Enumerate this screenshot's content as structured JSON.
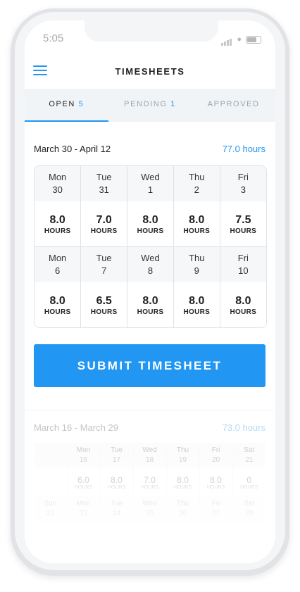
{
  "status_bar": {
    "time": "5:05"
  },
  "header": {
    "title": "TIMESHEETS"
  },
  "tabs": [
    {
      "label": "OPEN",
      "count": "5"
    },
    {
      "label": "PENDING",
      "count": "1"
    },
    {
      "label": "APPROVED",
      "count": ""
    }
  ],
  "current": {
    "range": "March 30 - April 12",
    "total": "77.0 hours",
    "weeks": [
      [
        {
          "day": "Mon",
          "date": "30",
          "hours": "8.0"
        },
        {
          "day": "Tue",
          "date": "31",
          "hours": "7.0"
        },
        {
          "day": "Wed",
          "date": "1",
          "hours": "8.0"
        },
        {
          "day": "Thu",
          "date": "2",
          "hours": "8.0"
        },
        {
          "day": "Fri",
          "date": "3",
          "hours": "7.5"
        }
      ],
      [
        {
          "day": "Mon",
          "date": "6",
          "hours": "8.0"
        },
        {
          "day": "Tue",
          "date": "7",
          "hours": "6.5"
        },
        {
          "day": "Wed",
          "date": "8",
          "hours": "8.0"
        },
        {
          "day": "Thu",
          "date": "9",
          "hours": "8.0"
        },
        {
          "day": "Fri",
          "date": "10",
          "hours": "8.0"
        }
      ]
    ],
    "hours_unit": "HOURS"
  },
  "submit_label": "SUBMIT TIMESHEET",
  "previous": {
    "range": "March 16 - March 29",
    "total": "73.0 hours",
    "week1": [
      {
        "day": "",
        "date": "",
        "hours": "",
        "unit": ""
      },
      {
        "day": "Mon",
        "date": "16",
        "hours": "6.0",
        "unit": "HOURS"
      },
      {
        "day": "Tue",
        "date": "17",
        "hours": "8.0",
        "unit": "HOURS"
      },
      {
        "day": "Wed",
        "date": "18",
        "hours": "7.0",
        "unit": "HOURS"
      },
      {
        "day": "Thu",
        "date": "19",
        "hours": "8.0",
        "unit": "HOURS"
      },
      {
        "day": "Fri",
        "date": "20",
        "hours": "8.0",
        "unit": "HOURS"
      },
      {
        "day": "Sat",
        "date": "21",
        "hours": "0",
        "unit": "HOURS"
      }
    ],
    "week2": [
      {
        "day": "Sun",
        "date": "22"
      },
      {
        "day": "Mon",
        "date": "23"
      },
      {
        "day": "Tue",
        "date": "24"
      },
      {
        "day": "Wed",
        "date": "25"
      },
      {
        "day": "Thu",
        "date": "26"
      },
      {
        "day": "Fri",
        "date": "27"
      },
      {
        "day": "Sat",
        "date": "28"
      }
    ]
  },
  "colors": {
    "accent": "#2196f3",
    "tab_bg": "#f1f4f7",
    "grid_border": "#dfe3e8"
  }
}
